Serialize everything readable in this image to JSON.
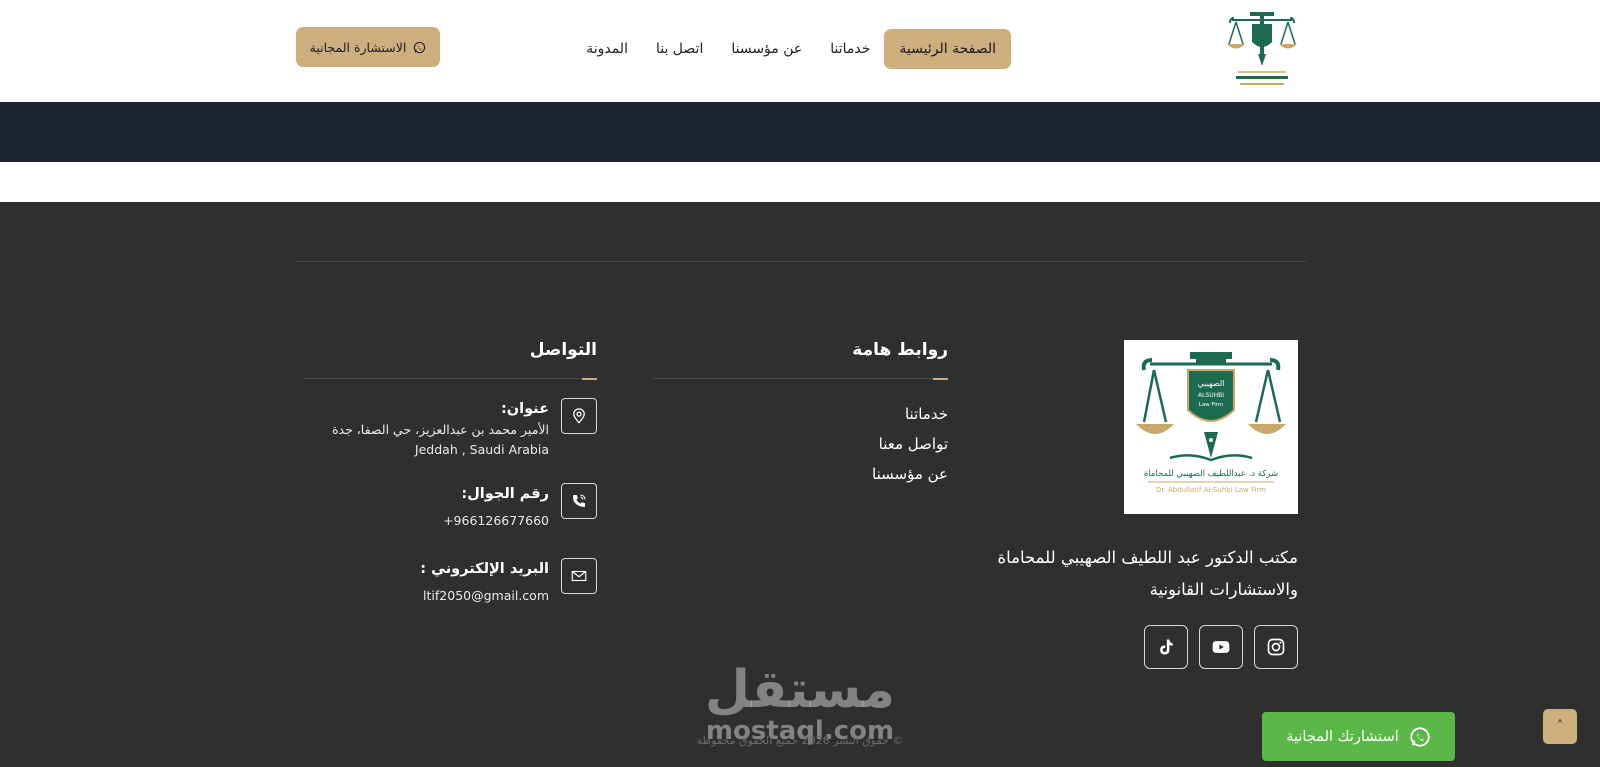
{
  "header": {
    "nav": [
      {
        "label": "الصفحة الرئيسية",
        "active": true
      },
      {
        "label": "خدماتنا",
        "active": false
      },
      {
        "label": "عن مؤسسنا",
        "active": false
      },
      {
        "label": "اتصل بنا",
        "active": false
      },
      {
        "label": "المدونة",
        "active": false
      }
    ],
    "cta_label": "الاستشارة المجانية"
  },
  "footer": {
    "brand_description": "مكتب الدكتور عبد اللطيف الصهيبي للمحاماة والاستشارات القانونية",
    "logo_text": {
      "ar_top": "الصهيبي",
      "en_badge": "ALSUHBI",
      "en_badge2": "Law Firm",
      "ar_name": "شركة د. عبداللطيف الصهيبي للمحاماة",
      "en_name": "Dr. Abdullatif Al-Suhbi Law Firm"
    },
    "socials": [
      "instagram-icon",
      "youtube-icon",
      "tiktok-icon"
    ],
    "links_title": "روابط هامة",
    "links": [
      "خدماتنا",
      "تواصل معنا",
      "عن مؤسسنا"
    ],
    "contact_title": "التواصل",
    "contact": {
      "address_label": "عنوان:",
      "address_line1": "الأمير محمد بن عبدالعزيز، حي الصفا، جدة",
      "address_line2": "Jeddah , Saudi Arabia",
      "phone_label": "رقم الجوال:",
      "phone": "+966126677660",
      "email_label": "البريد الإلكتروني :",
      "email": "ltif2050@gmail.com"
    },
    "copyright": "© حقوق النشر 2026 جميع الحقوق محفوظة",
    "watermark_ar": "مستقل",
    "watermark_en": "mostaql.com",
    "whatsapp_float": "استشارتك المجانية",
    "back_to_top": "˄"
  },
  "colors": {
    "accent": "#cdae7e",
    "footer_bg": "#2f2f2f",
    "band_bg": "#1e2530",
    "whatsapp": "#5bb848",
    "logo_green": "#1d6b4f"
  }
}
